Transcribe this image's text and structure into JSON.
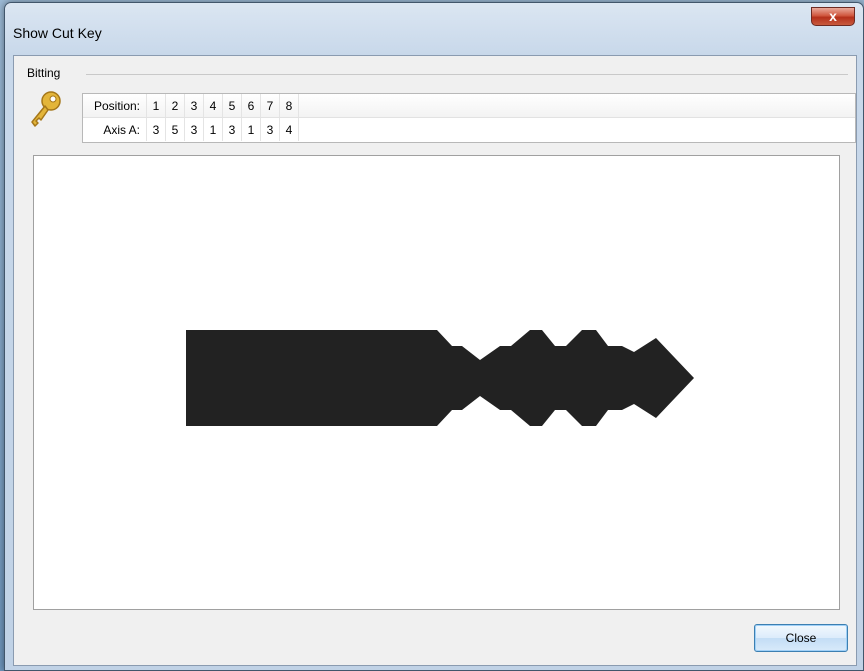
{
  "window": {
    "title": "Show Cut Key",
    "close_glyph": "x"
  },
  "group": {
    "label": "Bitting"
  },
  "bitting": {
    "position_label": "Position:",
    "axis_label": "Axis A:",
    "positions": [
      "1",
      "2",
      "3",
      "4",
      "5",
      "6",
      "7",
      "8"
    ],
    "axis_a": [
      "3",
      "5",
      "3",
      "1",
      "3",
      "1",
      "3",
      "4"
    ]
  },
  "icons": {
    "key": "key-icon"
  },
  "buttons": {
    "close_label": "Close"
  },
  "colors": {
    "key_fill": "#222222",
    "key_icon": "#e3b53a"
  }
}
